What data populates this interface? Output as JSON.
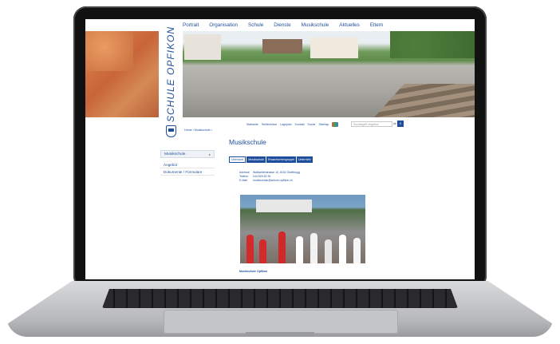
{
  "nav": [
    "Portrait",
    "Organisation",
    "Schule",
    "Dienste",
    "Musikschule",
    "Aktuelles",
    "Eltern"
  ],
  "brand": "SCHULE OPFIKON",
  "breadcrumb": "Home • Musikschule •",
  "utility_links": [
    "Startseite",
    "Stellenbörse",
    "Lageplan",
    "Kontakt",
    "Suche",
    "Sitemap"
  ],
  "search": {
    "placeholder": "Suchbegriff eingeben",
    "language": "de ▾",
    "button_icon": "search-icon"
  },
  "sidebar": {
    "active": "Musikschule",
    "items": [
      "Angebot",
      "Dokumente / Formulare"
    ]
  },
  "main": {
    "title": "Musikschule",
    "tabs": [
      "Übersicht",
      "Musikschule",
      "Erwachsenengruppe",
      "Unterricht"
    ],
    "info": [
      {
        "label": "Adresse",
        "value": "Wallisellerstrasse 10, 8152 Glattbrugg"
      },
      {
        "label": "Telefon",
        "value": "044 829 82 30"
      },
      {
        "label": "E-Mail",
        "value": "musikschule@schule-opfikon.ch"
      }
    ],
    "caption": "Musikschule Opfikon"
  },
  "colors": {
    "accent": "#1f4f9c"
  }
}
